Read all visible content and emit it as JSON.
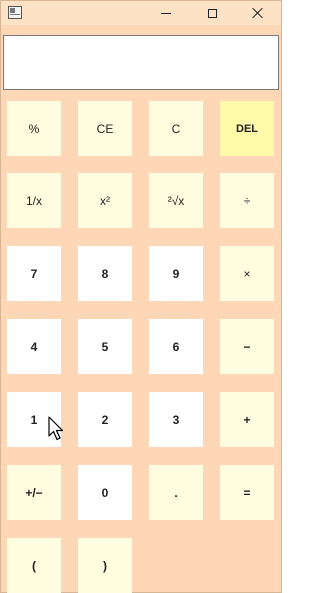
{
  "window": {
    "controls": {
      "minimize_icon": "minimize-icon",
      "maximize_icon": "maximize-icon",
      "close_icon": "close-icon"
    }
  },
  "display": {
    "value": ""
  },
  "keys": {
    "percent": "%",
    "ce": "CE",
    "c": "C",
    "del": "DEL",
    "reciprocal": "1/x",
    "square": "x²",
    "sqrt": "²√x",
    "divide": "÷",
    "seven": "7",
    "eight": "8",
    "nine": "9",
    "multiply": "×",
    "four": "4",
    "five": "5",
    "six": "6",
    "minus": "−",
    "one": "1",
    "two": "2",
    "three": "3",
    "plus": "+",
    "negate": "+/−",
    "zero": "0",
    "decimal": ".",
    "equals": "=",
    "open_paren": "(",
    "close_paren": ")"
  },
  "colors": {
    "window_bg": "#fed8b6",
    "key_light": "#fefde0",
    "key_white": "#ffffff",
    "key_del": "#fffba8"
  }
}
